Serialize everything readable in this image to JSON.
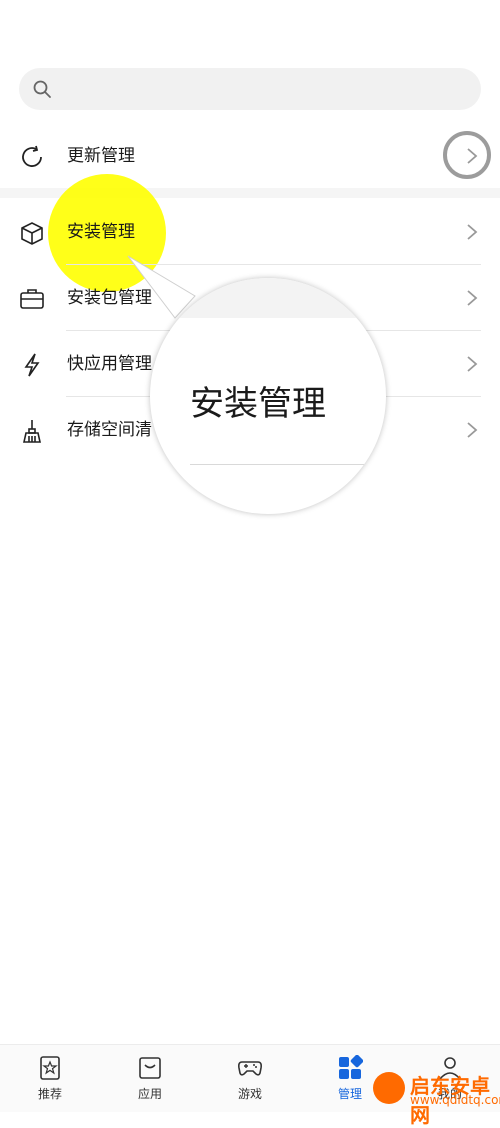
{
  "search": {
    "placeholder": ""
  },
  "list": {
    "items": [
      {
        "label": "更新管理",
        "icon": "refresh-icon"
      },
      {
        "label": "安装管理",
        "icon": "box-icon"
      },
      {
        "label": "安装包管理",
        "icon": "briefcase-icon"
      },
      {
        "label": "快应用管理",
        "icon": "lightning-icon"
      },
      {
        "label": "存储空间清",
        "icon": "broom-icon"
      }
    ]
  },
  "magnifier": {
    "text": "安装管理"
  },
  "tabbar": {
    "tabs": [
      {
        "label": "推荐",
        "icon": "star-icon",
        "active": false
      },
      {
        "label": "应用",
        "icon": "tray-icon",
        "active": false
      },
      {
        "label": "游戏",
        "icon": "gamepad-icon",
        "active": false
      },
      {
        "label": "管理",
        "icon": "grid-icon",
        "active": true
      },
      {
        "label": "我的",
        "icon": "user-icon",
        "active": false
      }
    ]
  },
  "watermark": {
    "title": "启东安卓网",
    "url": "www.qdldtq.com"
  },
  "colors": {
    "accent": "#1766dd",
    "highlight": "#ffff00",
    "watermark": "#ff6a00"
  }
}
